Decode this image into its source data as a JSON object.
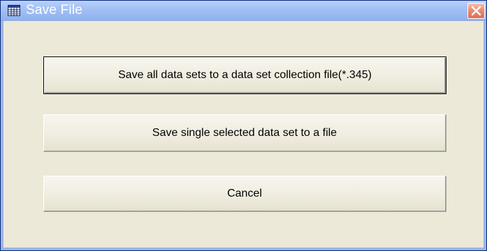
{
  "window": {
    "title": "Save File"
  },
  "buttons": {
    "save_all": "Save all data sets to a data set collection file(*.345)",
    "save_single": "Save single selected  data set to a  file",
    "cancel": "Cancel"
  },
  "icons": {
    "app": "table-icon",
    "close": "close-icon"
  },
  "colors": {
    "titlebar": "#a4c1f6",
    "dialog_background": "#ece9d8",
    "close_button": "#e2785c"
  }
}
